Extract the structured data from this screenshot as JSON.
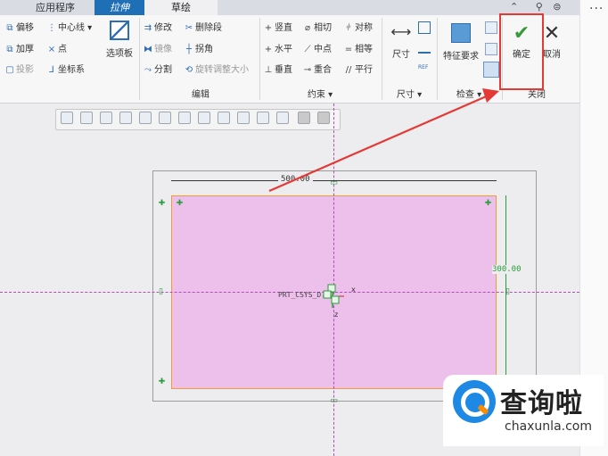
{
  "tabs": [
    "应用程序",
    "拉伸",
    "草绘"
  ],
  "ribbon": {
    "setup": {
      "items": [
        "偏移",
        "中心线",
        "加厚",
        "点",
        "投影",
        "坐标系"
      ],
      "options_button": "选项板"
    },
    "edit": {
      "label": "编辑",
      "items": [
        "修改",
        "删除段",
        "镜像",
        "拐角",
        "分割",
        "旋转调整大小"
      ]
    },
    "constrain": {
      "label": "约束",
      "items": [
        "竖直",
        "相切",
        "对称",
        "水平",
        "中点",
        "相等",
        "垂直",
        "重合",
        "平行"
      ]
    },
    "dimension": {
      "label": "尺寸",
      "button": "尺寸"
    },
    "inspect": {
      "label": "检查",
      "button": "特征要求"
    },
    "close": {
      "label": "关闭",
      "confirm": "确定",
      "cancel": "取消"
    }
  },
  "sketch": {
    "width_dim": "500.00",
    "height_dim": "300.00",
    "csys_label": "PRT_CSYS_D",
    "axis_x": "x",
    "axis_z": "z"
  },
  "watermark": {
    "brand": "查询啦",
    "url": "chaxunla.com"
  },
  "colors": {
    "accent": "#1f6fb7",
    "highlight_red": "#e53935",
    "sketch_fill": "#ecc0ea",
    "sketch_edge": "#f09a3a",
    "confirm_green": "#3a9a3a"
  }
}
